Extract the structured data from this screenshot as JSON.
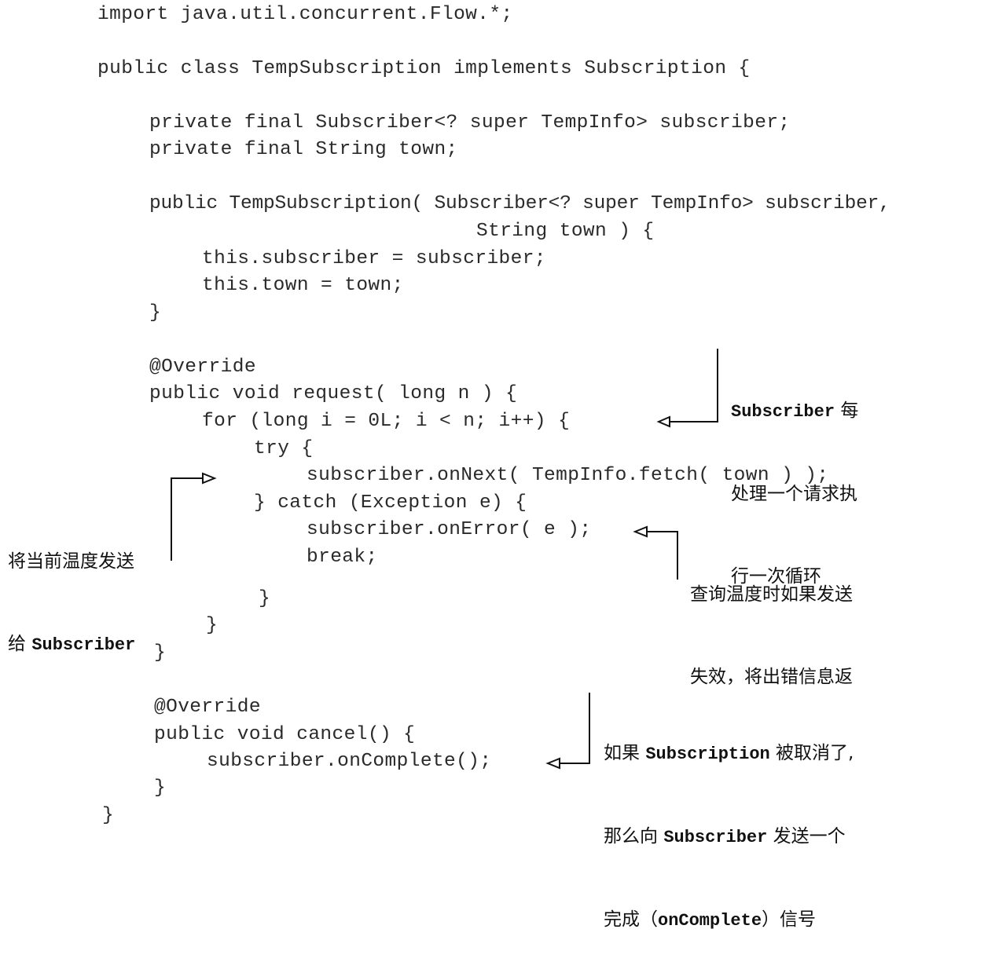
{
  "code": {
    "lines": [
      "import java.util.concurrent.Flow.*;",
      "public class TempSubscription implements Subscription {",
      "private final Subscriber<? super TempInfo> subscriber;",
      "private final String town;",
      "public TempSubscription( Subscriber<? super TempInfo> subscriber,",
      "String town ) {",
      "this.subscriber = subscriber;",
      "this.town = town;",
      "}",
      "@Override",
      "public void request( long n ) {",
      "for (long i = 0L; i < n; i++) {",
      "try {",
      "subscriber.onNext( TempInfo.fetch( town ) );",
      "} catch (Exception e) {",
      "subscriber.onError( e );",
      "break;",
      "}",
      "}",
      "}",
      "@Override",
      "public void cancel() {",
      "subscriber.onComplete();",
      "}",
      "}"
    ]
  },
  "annotations": {
    "request_loop": {
      "line1_mono": "Subscriber",
      "line1_text": " 每",
      "line2": "处理一个请求执",
      "line3": "行一次循环"
    },
    "on_next": {
      "line1": "将当前温度发送",
      "line2_text": "给 ",
      "line2_mono": "Subscriber"
    },
    "on_error": {
      "line1": "查询温度时如果发送",
      "line2": "失效，将出错信息返"
    },
    "on_complete": {
      "line1_text": "如果 ",
      "line1_mono": "Subscription",
      "line1_tail": " 被取消了,",
      "line2_text": "那么向 ",
      "line2_mono": "Subscriber",
      "line2_tail": " 发送一个",
      "line3_text": "完成（",
      "line3_mono": "onComplete",
      "line3_tail": "）信号"
    }
  }
}
